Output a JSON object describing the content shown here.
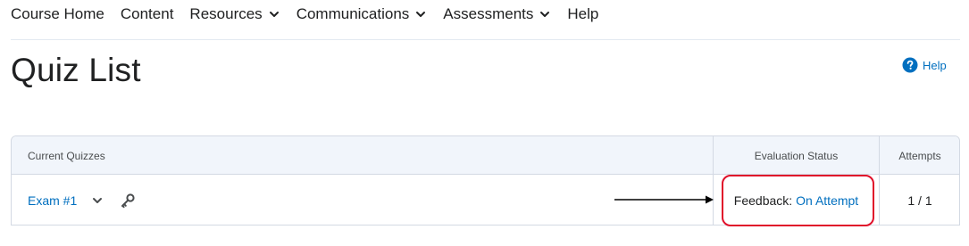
{
  "nav": {
    "items": [
      {
        "label": "Course Home",
        "has_menu": false
      },
      {
        "label": "Content",
        "has_menu": false
      },
      {
        "label": "Resources",
        "has_menu": true
      },
      {
        "label": "Communications",
        "has_menu": true
      },
      {
        "label": "Assessments",
        "has_menu": true
      },
      {
        "label": "Help",
        "has_menu": false
      }
    ]
  },
  "page": {
    "title": "Quiz List",
    "help_label": "Help",
    "help_icon": "question-circle-icon"
  },
  "table": {
    "headers": {
      "current": "Current Quizzes",
      "evaluation": "Evaluation Status",
      "attempts": "Attempts"
    },
    "rows": [
      {
        "quiz_name": "Exam #1",
        "feedback_label": "Feedback:",
        "feedback_value": "On Attempt",
        "attempts": "1 / 1"
      }
    ]
  },
  "annotation": {
    "highlight_color": "#e0102a",
    "arrow_color": "#000000"
  },
  "colors": {
    "link": "#006fbf",
    "header_bg": "#f1f5fb",
    "border": "#d3d9e3",
    "text": "#202122"
  }
}
